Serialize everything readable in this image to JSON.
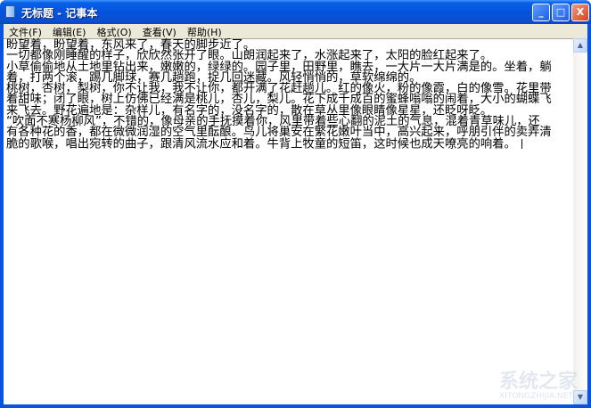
{
  "window": {
    "title": "无标题 - 记事本",
    "minimize": "_",
    "maximize": "□",
    "close": "X"
  },
  "menu": [
    "文件(F)",
    "编辑(E)",
    "格式(O)",
    "查看(V)",
    "帮助(H)"
  ],
  "content": {
    "lines": [
      "盼望着，盼望着，东风来了，春天的脚步近了。",
      "一切都像刚睡醒的样子，欣欣然张开了眼。山朗润起来了，水涨起来了，太阳的脸红起来了。",
      "小草偷偷地从土地里钻出来，嫩嫩的，绿绿的。园子里，田野里，瞧去，一大片一大片满是的。坐着，躺",
      "着，打两个滚，踢几脚球，赛几趟跑，捉几回迷藏。风轻悄悄的，草软绵绵的。",
      "桃树，杏树，梨树，你不让我，我不让你，都开满了花赶趟儿。红的像火，粉的像霞，白的像雪。花里带",
      "着甜味；闭了眼，树上仿佛已经满是桃儿，杏儿，梨儿。花下成千成百的蜜蜂嗡嗡的闹着，大小的蝴蝶飞",
      "来飞去。野花遍地是：杂样儿，有名字的，没名字的，散在草丛里像眼睛像星星，还眨呀眨。",
      "“吹面不寒杨柳风”，不错的，像母亲的手抚摸着你，风里带着些心翻的泥土的气息，混着青草味儿，还",
      "有各种花的香，都在微微润湿的空气里酝酿。鸟儿将巢安在繁花嫩叶当中，高兴起来，呼朋引伴的卖弄清",
      "脆的歌喉，唱出宛转的曲子，跟清风流水应和着。牛背上牧童的短笛，这时候也成天嘹亮的响着。"
    ]
  },
  "watermark": {
    "text": "系统之家",
    "url": "XITONGZHIJIA.NET"
  }
}
